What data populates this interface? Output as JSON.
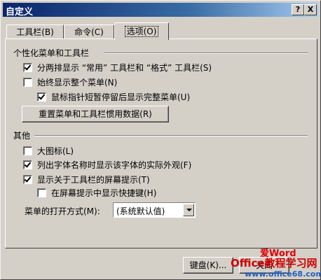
{
  "window": {
    "title": "自定义",
    "help_label": "?",
    "close_label": "X"
  },
  "tabs": [
    {
      "label": "工具栏(B)",
      "active": false
    },
    {
      "label": "命令(C)",
      "active": false
    },
    {
      "label": "选项(O)",
      "active": true
    }
  ],
  "personalized": {
    "group_title": "个性化菜单和工具栏",
    "options": [
      {
        "label": "分两排显示 “常用” 工具栏和 “格式” 工具栏(S)",
        "checked": true
      },
      {
        "label": "始终显示整个菜单(N)",
        "checked": false
      },
      {
        "label": "鼠标指针短暂停留后显示完整菜单(U)",
        "checked": true
      }
    ],
    "reset_button": "重置菜单和工具栏惯用数据(R)"
  },
  "other": {
    "group_title": "其他",
    "options": [
      {
        "label": "大图标(L)",
        "checked": false
      },
      {
        "label": "列出字体名称时显示该字体的实际外观(F)",
        "checked": true
      },
      {
        "label": "显示关于工具栏的屏幕提示(T)",
        "checked": true
      },
      {
        "label": "在屏幕提示中显示快捷键(H)",
        "checked": false
      }
    ],
    "animation_label": "菜单的打开方式(M):",
    "animation_value": "(系统默认值)"
  },
  "footer": {
    "keyboard_button": "键盘(K)...",
    "close_button": "关闭"
  },
  "watermark": {
    "line1": "Office教程学习网",
    "line2": "www.office68.com",
    "accent": "爱Word"
  }
}
